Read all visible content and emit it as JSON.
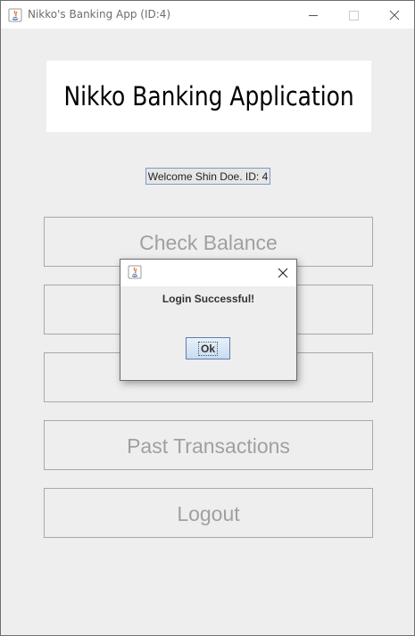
{
  "window": {
    "title": "Nikko's Banking App (ID:4)",
    "controls": {
      "minimize_icon": "minimize-icon",
      "maximize_icon": "maximize-icon",
      "close_icon": "close-icon"
    }
  },
  "header": {
    "title": "Nikko Banking Application"
  },
  "welcome": {
    "text": "Welcome Shin Doe. ID: 4"
  },
  "menu": {
    "buttons": [
      {
        "label": "Check Balance"
      },
      {
        "label": ""
      },
      {
        "label": ""
      },
      {
        "label": "Past Transactions"
      },
      {
        "label": "Logout"
      }
    ]
  },
  "dialog": {
    "message": "Login Successful!",
    "ok_label": "Ok",
    "icon": "java-icon",
    "close_icon": "close-icon"
  },
  "colors": {
    "background": "#eeeeee",
    "titlebar": "#ffffff",
    "button_text": "#a0a0a0",
    "button_border": "#a8a8a8",
    "ok_border": "#5f7fa8"
  }
}
